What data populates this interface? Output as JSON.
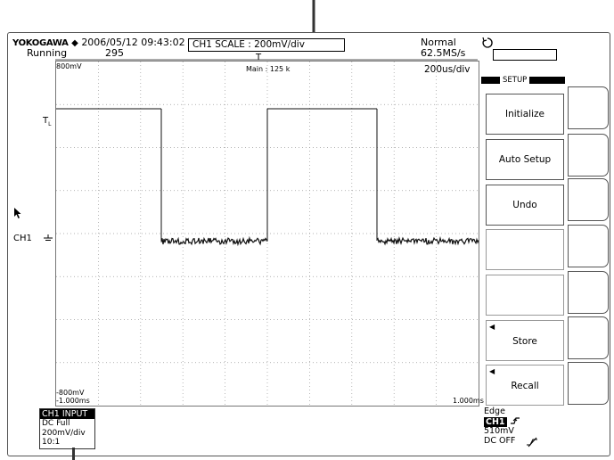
{
  "header": {
    "brand": "YOKOGAWA",
    "datetime": "2006/05/12 09:43:02",
    "status": "Running",
    "acq_count": "295",
    "scale_readout": "CH1  SCALE  :  200mV/div",
    "trigger_mode": "Normal",
    "sample_rate": "62.5MS/s"
  },
  "screen": {
    "top_level": "800mV",
    "main_info": "Main : 125 k",
    "time_div": "200us/div",
    "bottom_level": "-800mV",
    "time_left": "-1.000ms",
    "time_right": "1.000ms",
    "channel_label": "CH1"
  },
  "menu": {
    "title": "SETUP",
    "items": [
      {
        "label": "Initialize"
      },
      {
        "label": "Auto Setup"
      },
      {
        "label": "Undo"
      },
      {
        "label": ""
      },
      {
        "label": ""
      },
      {
        "label": "Store"
      },
      {
        "label": "Recall"
      }
    ]
  },
  "input": {
    "title": "CH1  INPUT",
    "coupling": "DC Full",
    "scale": "200mV/div",
    "probe": "10:1"
  },
  "trigger": {
    "type": "Edge",
    "source": "CH1",
    "level": "510mV",
    "hf_reject": "DC OFF"
  },
  "colors": {
    "waveform": "#111111",
    "grid": "#9a9a9a",
    "frame": "#555555"
  }
}
